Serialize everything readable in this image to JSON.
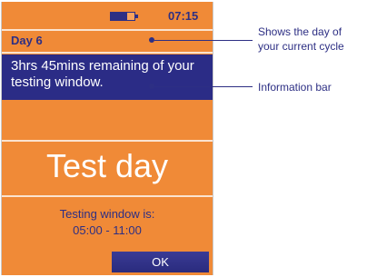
{
  "status": {
    "time": "07:15",
    "battery_level": 0.7
  },
  "day": {
    "label": "Day 6"
  },
  "info_bar": {
    "message": "3hrs 45mins remaining of your testing window."
  },
  "main": {
    "heading": "Test day"
  },
  "testing_window": {
    "title": "Testing window is:",
    "hours": "05:00 - 11:00"
  },
  "actions": {
    "ok_label": "OK"
  },
  "annotations": {
    "day_line1": "Shows the day of",
    "day_line2": "your current cycle",
    "info_bar": "Information bar"
  },
  "colors": {
    "screen_background": "#f08a37",
    "info_bar_background": "#2b2c86",
    "accent_text": "#2d2f84",
    "button": "#2f3088"
  }
}
